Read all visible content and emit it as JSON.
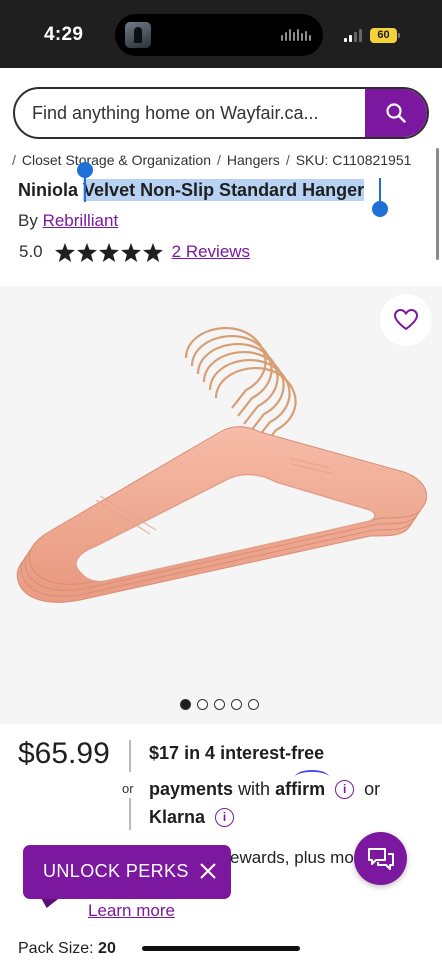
{
  "status_bar": {
    "time": "4:29",
    "battery": "60",
    "colors": {
      "background": "#1f1f1f",
      "battery": "#f4d23a"
    }
  },
  "search": {
    "placeholder": "Find anything home on Wayfair.ca...",
    "button_icon": "search-icon"
  },
  "breadcrumb": {
    "items": [
      "Closet Storage & Organization",
      "Hangers"
    ],
    "sku": "SKU: C110821951"
  },
  "product": {
    "brand_prefix": "Niniola",
    "name": "Velvet Non-Slip Standard Hanger",
    "by_label": "By",
    "brand": "Rebrilliant",
    "rating": "5.0",
    "stars": 5,
    "reviews": "2 Reviews",
    "image_count": 5,
    "active_image": 1
  },
  "pricing": {
    "price": "$65.99",
    "or_label": "or",
    "installment_amount": "$17",
    "installment_text": "in 4 interest-free",
    "payments_label": "payments",
    "with_label": "with",
    "affirm": "affirm",
    "or_klarna_label": "or",
    "klarna": "Klarna"
  },
  "rewards": {
    "text": "ewards, plus mo",
    "learn_more": "Learn more"
  },
  "perks_banner": {
    "label": "UNLOCK PERKS",
    "close_icon": "close-icon"
  },
  "options": {
    "pack_size_label": "Pack Size:",
    "pack_size_value": "20"
  },
  "theme": {
    "accent": "#7b189f",
    "selection_highlight": "#b7d2f3",
    "selection_handle": "#1f6fd8",
    "hanger_color": "#f0ad97"
  }
}
